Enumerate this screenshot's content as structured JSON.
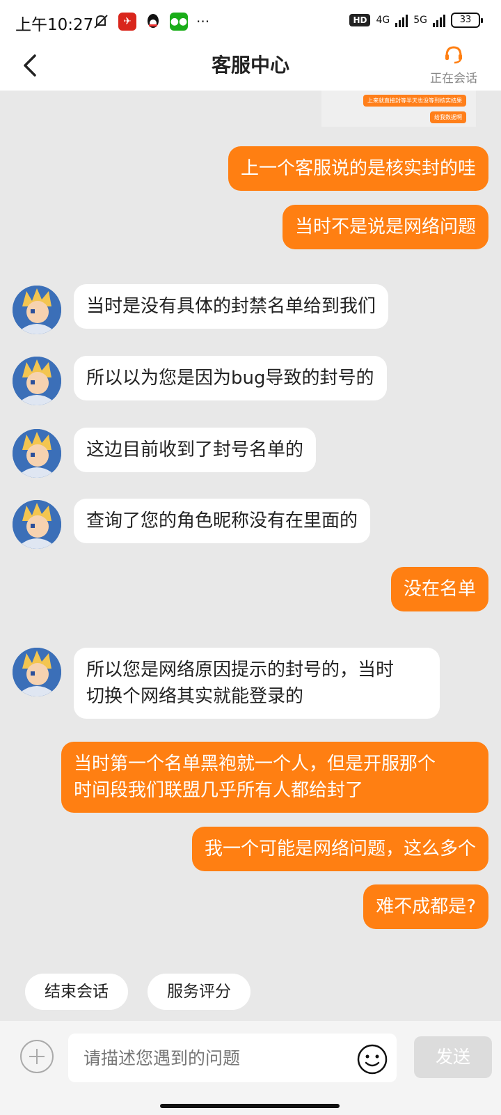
{
  "status": {
    "time": "上午10:27",
    "network_badge": "HD",
    "net_4g": "4G",
    "net_5g": "5G",
    "battery": "33"
  },
  "header": {
    "title": "客服中心",
    "agent_status": "正在会话"
  },
  "chat": {
    "preview": [
      "上来就直接封等半天也没等到核实结果",
      "给我数据啊"
    ],
    "messages": [
      {
        "from": "user",
        "text": "上一个客服说的是核实封的哇"
      },
      {
        "from": "user",
        "text": "当时不是说是网络问题"
      },
      {
        "from": "agent",
        "text": "当时是没有具体的封禁名单给到我们"
      },
      {
        "from": "agent",
        "text": "所以以为您是因为bug导致的封号的"
      },
      {
        "from": "agent",
        "text": "这边目前收到了封号名单的"
      },
      {
        "from": "agent",
        "text": "查询了您的角色昵称没有在里面的"
      },
      {
        "from": "user",
        "text": "没在名单"
      },
      {
        "from": "agent",
        "lines": [
          "所以您是网络原因提示的封号的，当时",
          "切换个网络其实就能登录的"
        ]
      },
      {
        "from": "user",
        "lines": [
          "当时第一个名单黑袍就一个人，但是开服那个",
          "时间段我们联盟几乎所有人都给封了"
        ]
      },
      {
        "from": "user",
        "text": "我一个可能是网络问题，这么多个"
      },
      {
        "from": "user",
        "text": "难不成都是?"
      }
    ]
  },
  "quick_actions": {
    "end": "结束会话",
    "rate": "服务评分"
  },
  "composer": {
    "placeholder": "请描述您遇到的问题",
    "send": "发送"
  },
  "colors": {
    "accent": "#ff7f12",
    "chat_bg": "#e8e8e8"
  }
}
